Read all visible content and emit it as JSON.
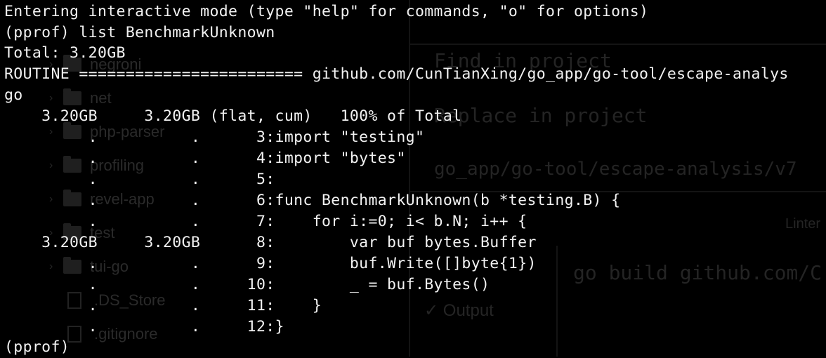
{
  "background_ide": {
    "tree_items": [
      {
        "label": "negroni",
        "kind": "folder"
      },
      {
        "label": "net",
        "kind": "folder"
      },
      {
        "label": "php-parser",
        "kind": "folder"
      },
      {
        "label": "profiling",
        "kind": "folder"
      },
      {
        "label": "revel-app",
        "kind": "folder"
      },
      {
        "label": "test",
        "kind": "folder"
      },
      {
        "label": "tui-go",
        "kind": "folder"
      },
      {
        "label": ".DS_Store",
        "kind": "file"
      },
      {
        "label": ".gitignore",
        "kind": "file"
      }
    ],
    "find_in_project": "Find in project",
    "replace_in_project": "Replace in project",
    "search_path": "go_app/go-tool/escape-analysis/v7",
    "linter_tab": "Linter",
    "build_command": "go build github.com/C",
    "output_tab": "Output"
  },
  "terminal": {
    "lines": [
      "Entering interactive mode (type \"help\" for commands, \"o\" for options)",
      "(pprof) list BenchmarkUnknown",
      "Total: 3.20GB",
      "ROUTINE ======================== github.com/CunTianXing/go_app/go-tool/escape-analys",
      "go",
      "    3.20GB     3.20GB (flat, cum)   100% of Total",
      "         .          .      3:import \"testing\"",
      "         .          .      4:import \"bytes\"",
      "         .          .      5:",
      "         .          .      6:func BenchmarkUnknown(b *testing.B) {",
      "         .          .      7:    for i:=0; i< b.N; i++ {",
      "    3.20GB     3.20GB      8:        var buf bytes.Buffer",
      "         .          .      9:        buf.Write([]byte{1})",
      "         .          .     10:        _ = buf.Bytes()",
      "         .          .     11:    }",
      "         .          .     12:}",
      "(pprof)"
    ]
  }
}
